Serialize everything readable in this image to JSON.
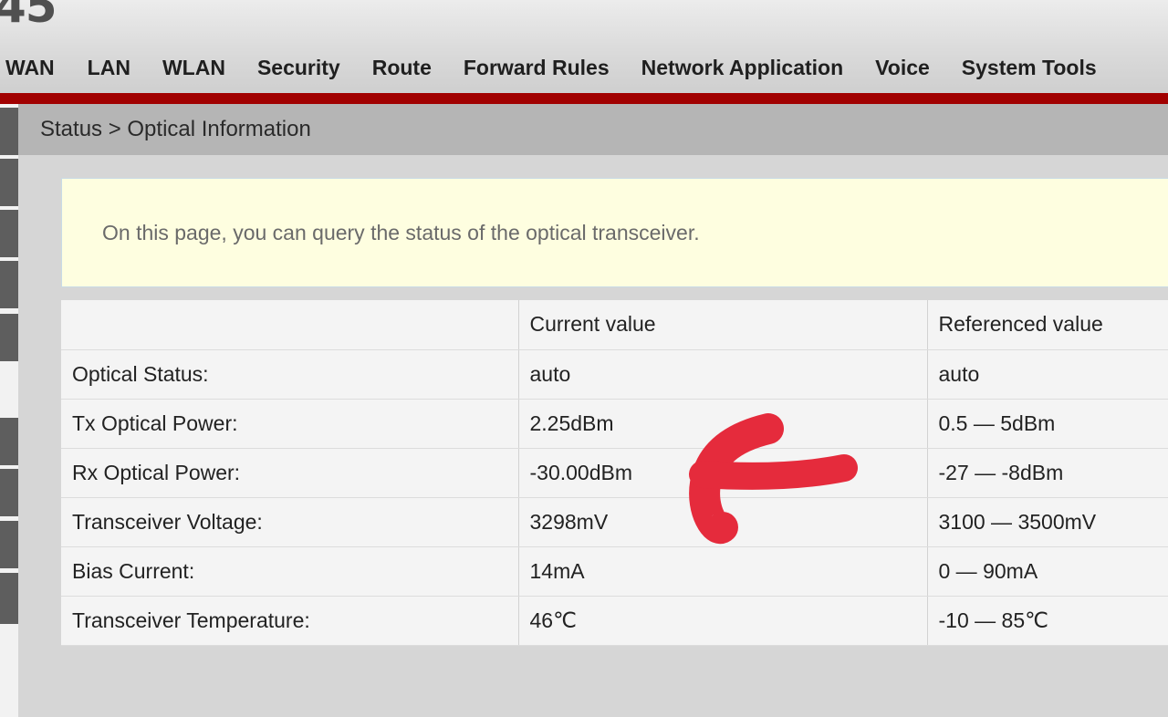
{
  "header": {
    "model_fragment": "45",
    "nav": [
      "WAN",
      "LAN",
      "WLAN",
      "Security",
      "Route",
      "Forward Rules",
      "Network Application",
      "Voice",
      "System Tools"
    ]
  },
  "breadcrumb": "Status > Optical Information",
  "notice": "On this page, you can query the status of the optical transceiver.",
  "table": {
    "headers": [
      "",
      "Current value",
      "Referenced value"
    ],
    "rows": [
      [
        "Optical Status:",
        "auto",
        "auto"
      ],
      [
        "Tx Optical Power:",
        "2.25dBm",
        "0.5 — 5dBm"
      ],
      [
        "Rx Optical Power:",
        "-30.00dBm",
        "-27 — -8dBm"
      ],
      [
        "Transceiver Voltage:",
        "3298mV",
        "3100 — 3500mV"
      ],
      [
        "Bias Current:",
        "14mA",
        "0 — 90mA"
      ],
      [
        "Transceiver Temperature:",
        "46℃",
        "-10 — 85℃"
      ]
    ]
  },
  "annotation": {
    "icon": "red-arrow-icon",
    "color": "#e52b3c"
  },
  "colors": {
    "accent_bar": "#a10000",
    "notice_bg": "#fefee0"
  }
}
